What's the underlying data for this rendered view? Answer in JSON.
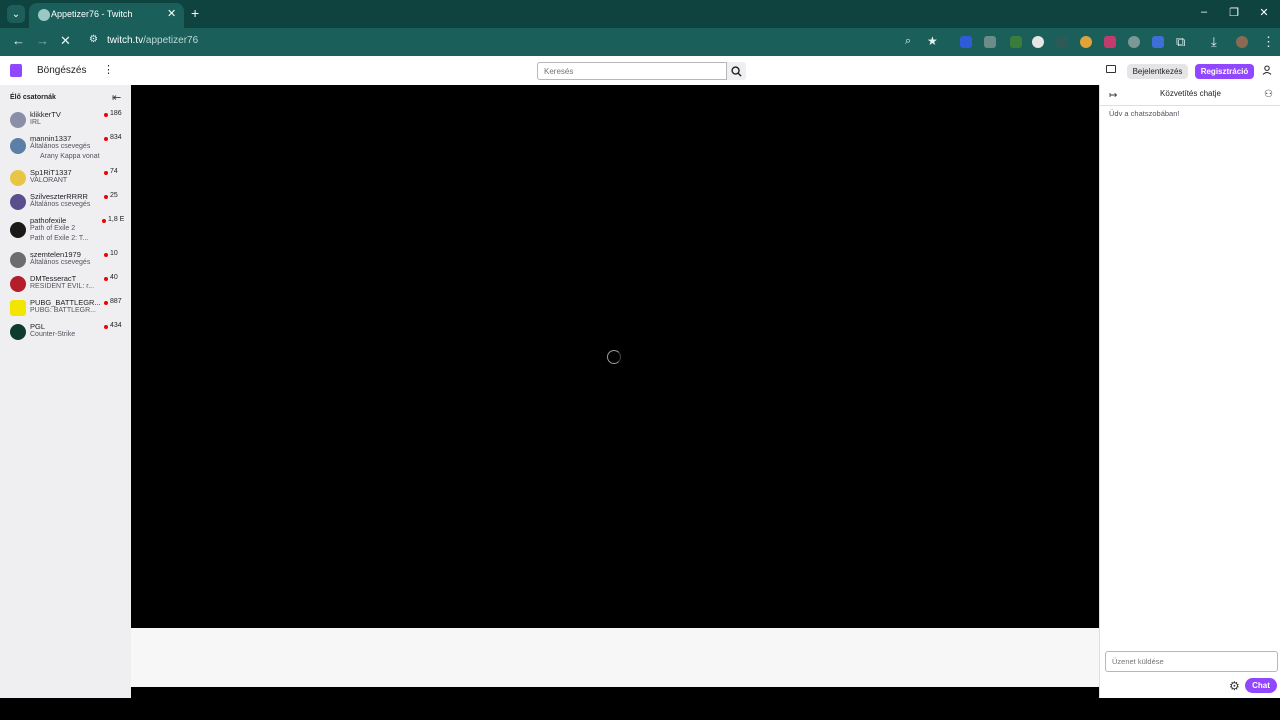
{
  "browser": {
    "tab_menu_icon": "chevron-down-icon",
    "tab_title": "Appetizer76 - Twitch",
    "new_tab": "+",
    "url_domain": "twitch.tv",
    "url_path": "/appetizer76",
    "window_controls": [
      "–",
      "❐",
      "✕"
    ]
  },
  "topnav": {
    "browse": "Böngészés",
    "search_placeholder": "Keresés",
    "login": "Bejelentkezés",
    "register": "Regisztráció"
  },
  "sidebar": {
    "title": "Élő csatornák",
    "channels": [
      {
        "name": "klikkerTV",
        "game": "IRL",
        "viewers": "186",
        "color": "#8a8fa8"
      },
      {
        "name": "mannin1337",
        "game": "Általános csevegés",
        "viewers": "834",
        "extra": "Arany Kappa vonat",
        "color": "#5b7fa6"
      },
      {
        "name": "Sp1RiT1337",
        "game": "VALORANT",
        "viewers": "74",
        "color": "#e8c447"
      },
      {
        "name": "SzilveszterRRRR",
        "game": "Általános csevegés",
        "viewers": "25",
        "color": "#5a4e8c"
      },
      {
        "name": "pathofexile",
        "game": "Path of Exile 2",
        "viewers": "1,8 E",
        "extra": "Path of Exile 2: T...",
        "color": "#1c1a18"
      },
      {
        "name": "szemtelen1979",
        "game": "Általános csevegés",
        "viewers": "10",
        "color": "#6d6d6d"
      },
      {
        "name": "DMTesseracT",
        "game": "RESIDENT EVIL: r...",
        "viewers": "40",
        "color": "#b31e2a"
      },
      {
        "name": "PUBG_BATTLEGR...",
        "game": "PUBG: BATTLEGR...",
        "viewers": "887",
        "color": "#f2e600"
      },
      {
        "name": "PGL",
        "game": "Counter-Strike",
        "viewers": "434",
        "color": "#0e3b2e"
      }
    ]
  },
  "chat": {
    "title": "Közvetítés chatje",
    "welcome": "Üdv a chatszobában!",
    "input_placeholder": "Üzenet küldése",
    "send": "Chat"
  },
  "colors": {
    "accent": "#9146ff",
    "live_dot": "#eb0400",
    "browser_frame": "#0f4340",
    "browser_toolbar": "#1b5f5b"
  }
}
